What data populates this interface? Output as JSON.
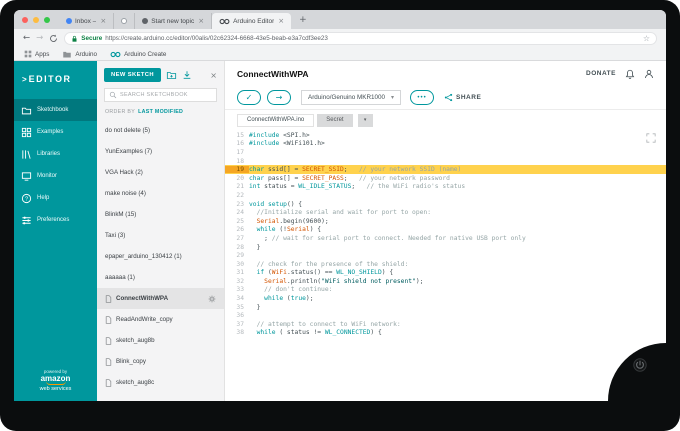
{
  "theme": {
    "accent": "#00979d",
    "accent_dark": "#00787e",
    "highlight": "#ffd24d",
    "orange": "#d35400",
    "secure_green": "#0b8043"
  },
  "browser": {
    "new_tab_glyph": "+",
    "back_glyph": "←",
    "forward_glyph": "→",
    "bookmark_star_glyph": "☆",
    "tab_close_glyph": "×",
    "tabs": [
      {
        "label": "Inbox –",
        "favicon": "mail",
        "closable": true,
        "active": false
      },
      {
        "label": "",
        "favicon": "circle",
        "closable": false,
        "active": false
      },
      {
        "label": "Start new topic",
        "favicon": "discourse",
        "closable": true,
        "active": false
      },
      {
        "label": "Arduino Editor",
        "favicon": "arduino-infinity",
        "closable": true,
        "active": true
      }
    ],
    "address": {
      "secure_label": "Secure",
      "url": "https://create.arduino.cc/editor/00alis/02c62324-6668-43e5-beab-e3a7cdf3ee23"
    },
    "bookmarks": [
      {
        "label": "Apps",
        "icon": "apps-grid"
      },
      {
        "label": "Arduino",
        "icon": "folder"
      },
      {
        "label": "Arduino Create",
        "icon": "arduino-infinity"
      }
    ]
  },
  "sidebar": {
    "logo_mark": ">",
    "logo_text": "EDITOR",
    "items": [
      {
        "label": "Sketchbook",
        "icon": "sketchbook",
        "active": true
      },
      {
        "label": "Examples",
        "icon": "examples",
        "active": false
      },
      {
        "label": "Libraries",
        "icon": "libraries",
        "active": false
      },
      {
        "label": "Monitor",
        "icon": "monitor",
        "active": false
      },
      {
        "label": "Help",
        "icon": "help",
        "active": false
      },
      {
        "label": "Preferences",
        "icon": "preferences",
        "active": false
      }
    ],
    "aws": {
      "powered_by": "powered by",
      "line1": "amazon",
      "line2": "web services"
    }
  },
  "sketchbook_panel": {
    "new_sketch_label": "NEW SKETCH",
    "close_glyph": "×",
    "search_placeholder": "SEARCH SKETCHBOOK",
    "order_by_label": "ORDER BY",
    "order_by_value": "LAST MODIFIED",
    "items": [
      {
        "label": "do not delete (5)",
        "type": "folder",
        "selected": false
      },
      {
        "label": "YunExamples (7)",
        "type": "folder",
        "selected": false
      },
      {
        "label": "VGA Hack (2)",
        "type": "folder",
        "selected": false
      },
      {
        "label": "make noise (4)",
        "type": "folder",
        "selected": false
      },
      {
        "label": "BlinkM (15)",
        "type": "folder",
        "selected": false
      },
      {
        "label": "Taxi (3)",
        "type": "folder",
        "selected": false
      },
      {
        "label": "epaper_arduino_130412 (1)",
        "type": "folder",
        "selected": false
      },
      {
        "label": "aaaaaa (1)",
        "type": "folder",
        "selected": false
      },
      {
        "label": "ConnectWithWPA",
        "type": "sketch",
        "selected": true
      },
      {
        "label": "ReadAndWrite_copy",
        "type": "sketch",
        "selected": false
      },
      {
        "label": "sketch_aug8b",
        "type": "sketch",
        "selected": false
      },
      {
        "label": "Blink_copy",
        "type": "sketch",
        "selected": false
      },
      {
        "label": "sketch_aug8c",
        "type": "sketch",
        "selected": false
      }
    ]
  },
  "editor": {
    "title": "ConnectWithWPA",
    "donate_label": "DONATE",
    "verify_glyph": "✓",
    "upload_glyph": "→",
    "board_selector": "Arduino/Genuino MKR1000",
    "board_dropdown_glyph": "▾",
    "dots_label": "•••",
    "share_label": "SHARE",
    "file_tabs_more_glyph": "▾",
    "file_tabs": [
      {
        "label": "ConnectWithWPA.ino",
        "active": true
      },
      {
        "label": "Secret",
        "active": false
      }
    ],
    "code_lines": [
      {
        "no": 15,
        "segs": [
          [
            "k",
            "#include"
          ],
          [
            "p",
            " <SPI.h>"
          ]
        ]
      },
      {
        "no": 16,
        "segs": [
          [
            "k",
            "#include"
          ],
          [
            "p",
            " <WiFi101.h>"
          ]
        ]
      },
      {
        "no": 17,
        "segs": []
      },
      {
        "no": 18,
        "segs": []
      },
      {
        "no": 19,
        "hl": true,
        "segs": [
          [
            "k",
            "char"
          ],
          [
            "p",
            " ssid[] = "
          ],
          [
            "o",
            "SECRET_SSID"
          ],
          [
            "p",
            ";   "
          ],
          [
            "c",
            "// your network SSID (name)"
          ]
        ]
      },
      {
        "no": 20,
        "segs": [
          [
            "k",
            "char"
          ],
          [
            "p",
            " pass[] = "
          ],
          [
            "o",
            "SECRET_PASS"
          ],
          [
            "p",
            ";   "
          ],
          [
            "c",
            "// your network password"
          ]
        ]
      },
      {
        "no": 21,
        "segs": [
          [
            "k",
            "int"
          ],
          [
            "p",
            " status = "
          ],
          [
            "t",
            "WL_IDLE_STATUS"
          ],
          [
            "p",
            ";   "
          ],
          [
            "c",
            "// the WiFi radio's status"
          ]
        ]
      },
      {
        "no": 22,
        "segs": []
      },
      {
        "no": 23,
        "segs": [
          [
            "k",
            "void"
          ],
          [
            "p",
            " "
          ],
          [
            "t",
            "setup"
          ],
          [
            "p",
            "() {"
          ]
        ]
      },
      {
        "no": 24,
        "segs": [
          [
            "p",
            "  "
          ],
          [
            "c",
            "//Initialize serial and wait for port to open:"
          ]
        ]
      },
      {
        "no": 25,
        "segs": [
          [
            "p",
            "  "
          ],
          [
            "o",
            "Serial"
          ],
          [
            "p",
            ".begin("
          ],
          [
            "n",
            "9600"
          ],
          [
            "p",
            ");"
          ]
        ]
      },
      {
        "no": 26,
        "segs": [
          [
            "p",
            "  "
          ],
          [
            "k",
            "while"
          ],
          [
            "p",
            " (!"
          ],
          [
            "o",
            "Serial"
          ],
          [
            "p",
            ") {"
          ]
        ]
      },
      {
        "no": 27,
        "segs": [
          [
            "p",
            "    ; "
          ],
          [
            "c",
            "// wait for serial port to connect. Needed for native USB port only"
          ]
        ]
      },
      {
        "no": 28,
        "segs": [
          [
            "p",
            "  }"
          ]
        ]
      },
      {
        "no": 29,
        "segs": []
      },
      {
        "no": 30,
        "segs": [
          [
            "p",
            "  "
          ],
          [
            "c",
            "// check for the presence of the shield:"
          ]
        ]
      },
      {
        "no": 31,
        "segs": [
          [
            "p",
            "  "
          ],
          [
            "k",
            "if"
          ],
          [
            "p",
            " ("
          ],
          [
            "o",
            "WiFi"
          ],
          [
            "p",
            ".status() == "
          ],
          [
            "t",
            "WL_NO_SHIELD"
          ],
          [
            "p",
            ") {"
          ]
        ]
      },
      {
        "no": 32,
        "segs": [
          [
            "p",
            "    "
          ],
          [
            "o",
            "Serial"
          ],
          [
            "p",
            ".println("
          ],
          [
            "s",
            "\"WiFi shield not present\""
          ],
          [
            "p",
            ");"
          ]
        ]
      },
      {
        "no": 33,
        "segs": [
          [
            "p",
            "    "
          ],
          [
            "c",
            "// don't continue:"
          ]
        ]
      },
      {
        "no": 34,
        "segs": [
          [
            "p",
            "    "
          ],
          [
            "k",
            "while"
          ],
          [
            "p",
            " ("
          ],
          [
            "t",
            "true"
          ],
          [
            "p",
            ");"
          ]
        ]
      },
      {
        "no": 35,
        "segs": [
          [
            "p",
            "  }"
          ]
        ]
      },
      {
        "no": 36,
        "segs": []
      },
      {
        "no": 37,
        "segs": [
          [
            "p",
            "  "
          ],
          [
            "c",
            "// attempt to connect to WiFi network:"
          ]
        ]
      },
      {
        "no": 38,
        "segs": [
          [
            "p",
            "  "
          ],
          [
            "k",
            "while"
          ],
          [
            "p",
            " ( status != "
          ],
          [
            "t",
            "WL_CONNECTED"
          ],
          [
            "p",
            ") {"
          ]
        ]
      }
    ]
  }
}
